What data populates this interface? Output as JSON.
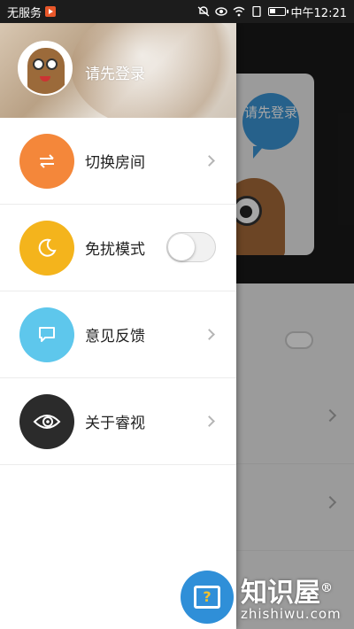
{
  "status_bar": {
    "carrier": "无服务",
    "time": "中午12:21"
  },
  "background_app": {
    "bubble_text": "请先登录"
  },
  "drawer": {
    "login_prompt": "请先登录",
    "items": [
      {
        "label": "切换房间",
        "icon": "swap-icon",
        "color": "#f4873a",
        "control": "chevron"
      },
      {
        "label": "免扰模式",
        "icon": "moon-icon",
        "color": "#f4b41c",
        "control": "toggle",
        "toggle_on": false
      },
      {
        "label": "意见反馈",
        "icon": "message-icon",
        "color": "#5ec7ec",
        "control": "chevron"
      },
      {
        "label": "关于睿视",
        "icon": "eye-icon",
        "color": "#2b2b2b",
        "control": "chevron"
      }
    ]
  },
  "watermark": {
    "title": "知识屋",
    "registered": "®",
    "url": "zhishiwu.com",
    "icon_glyph": "?"
  }
}
